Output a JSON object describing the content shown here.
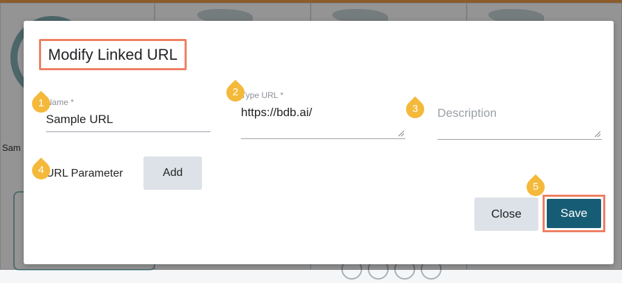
{
  "background": {
    "partial_text": "Sam"
  },
  "modal": {
    "title": "Modify Linked URL",
    "name_field": {
      "label": "Name *",
      "value": "Sample URL"
    },
    "type_url_field": {
      "label": "Type URL *",
      "value": "https://bdb.ai/"
    },
    "description_field": {
      "placeholder": "Description"
    },
    "url_parameter_label": "URL Parameter",
    "add_button_label": "Add",
    "close_button_label": "Close",
    "save_button_label": "Save"
  },
  "callouts": [
    "1",
    "2",
    "3",
    "4",
    "5"
  ],
  "colors": {
    "callout": "#f4b93a",
    "highlight_border": "#ee7f63",
    "save_button": "#165c74",
    "secondary_button": "#dde2e8"
  }
}
